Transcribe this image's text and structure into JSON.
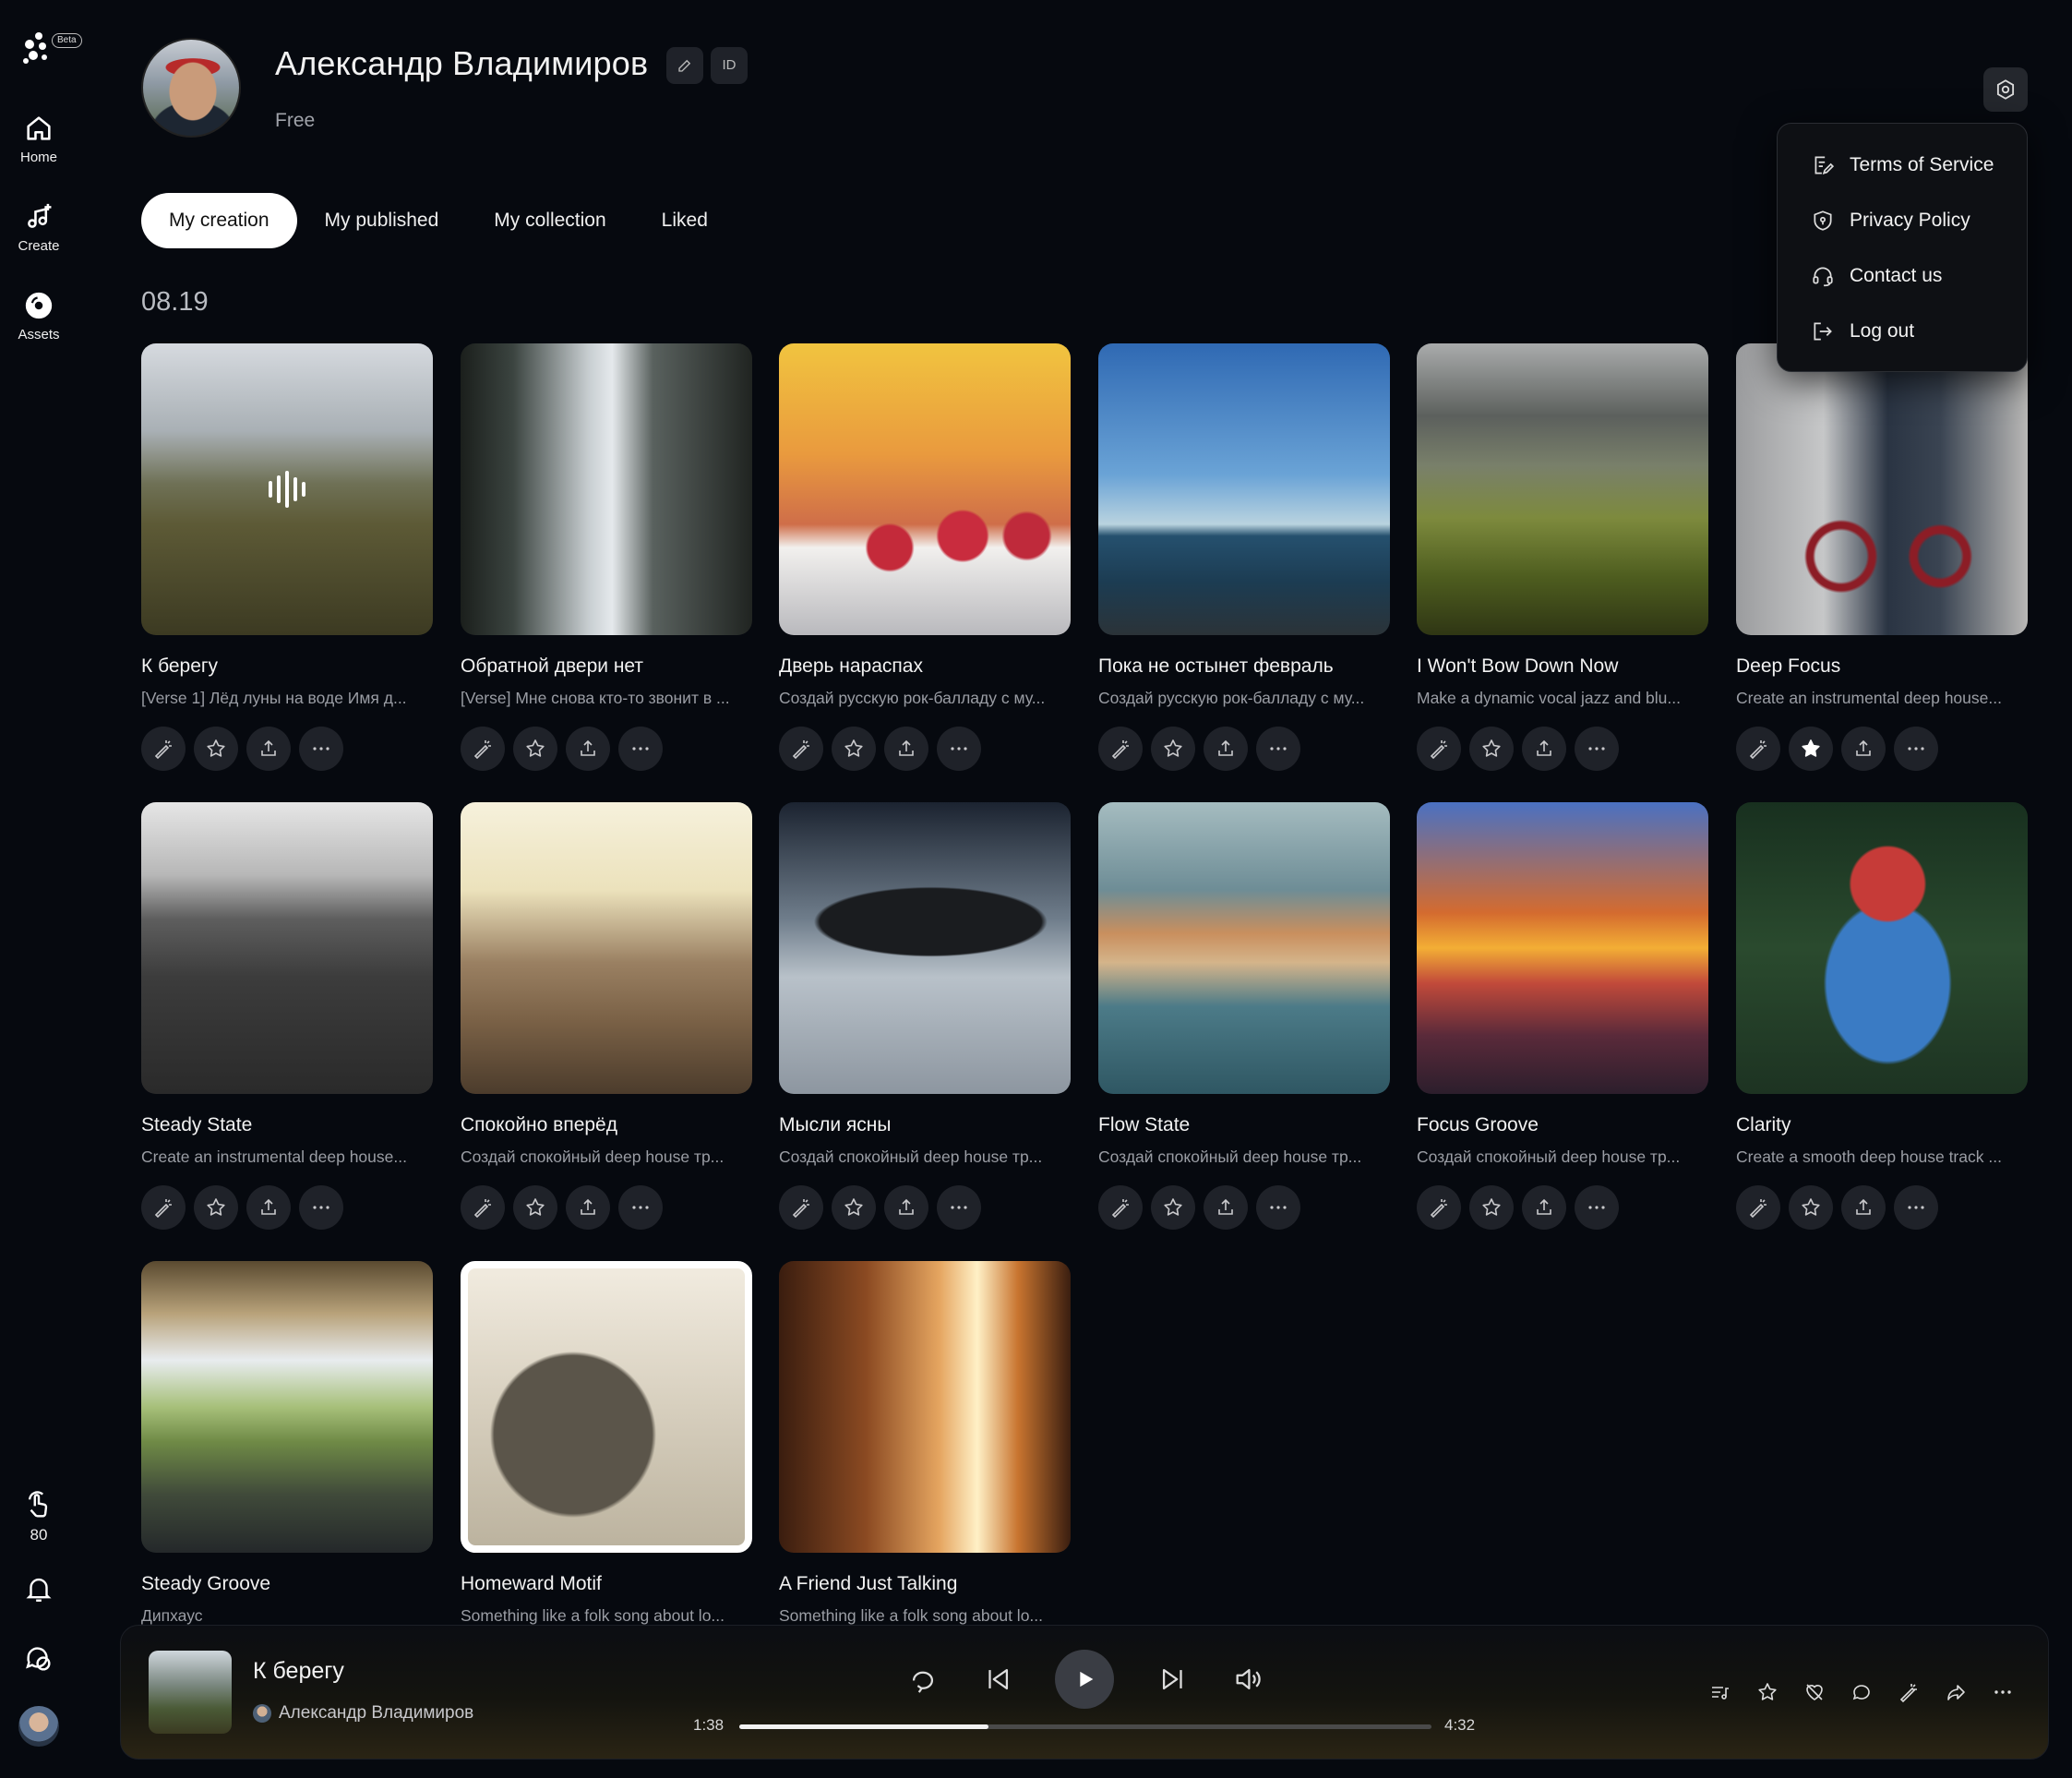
{
  "app": {
    "beta_label": "Beta"
  },
  "sidebar": {
    "items": [
      {
        "label": "Home",
        "icon": "home-icon"
      },
      {
        "label": "Create",
        "icon": "music-plus-icon"
      },
      {
        "label": "Assets",
        "icon": "disc-icon"
      }
    ],
    "credits": "80"
  },
  "profile": {
    "name": "Александр Владимиров",
    "plan": "Free",
    "id_label": "ID"
  },
  "tabs": [
    "My creation",
    "My published",
    "My collection",
    "Liked"
  ],
  "active_tab": "My creation",
  "date_group": "08.19",
  "menu": {
    "items": [
      {
        "label": "Terms of Service",
        "icon": "document-edit-icon"
      },
      {
        "label": "Privacy Policy",
        "icon": "shield-icon"
      },
      {
        "label": "Contact us",
        "icon": "headset-icon"
      },
      {
        "label": "Log out",
        "icon": "logout-icon"
      }
    ]
  },
  "cards": [
    {
      "title": "К берегу",
      "desc": "[Verse 1] Лёд луны на воде Имя д...",
      "starred": false,
      "playing": true
    },
    {
      "title": "Обратной двери нет",
      "desc": "[Verse] Мне снова кто-то звонит в ...",
      "starred": false
    },
    {
      "title": "Дверь нараспах",
      "desc": "Создай русскую рок-балладу с му...",
      "starred": false
    },
    {
      "title": "Пока не остынет февраль",
      "desc": "Создай русскую рок-балладу с му...",
      "starred": false
    },
    {
      "title": "I Won't Bow Down Now",
      "desc": "Make a dynamic vocal jazz and blu...",
      "starred": false
    },
    {
      "title": "Deep Focus",
      "desc": "Create an instrumental deep house...",
      "starred": true
    },
    {
      "title": "Steady State",
      "desc": "Create an instrumental deep house...",
      "starred": false
    },
    {
      "title": "Спокойно вперёд",
      "desc": "Создай спокойный deep house тр...",
      "starred": false
    },
    {
      "title": "Мысли ясны",
      "desc": "Создай спокойный deep house тр...",
      "starred": false
    },
    {
      "title": "Flow State",
      "desc": "Создай спокойный deep house тр...",
      "starred": false
    },
    {
      "title": "Focus Groove",
      "desc": "Создай спокойный deep house тр...",
      "starred": false
    },
    {
      "title": "Clarity",
      "desc": "Create a smooth deep house track ...",
      "starred": false
    },
    {
      "title": "Steady Groove",
      "desc": "Дипхаус",
      "starred": false
    },
    {
      "title": "Homeward Motif",
      "desc": "Something like a folk song about lo...",
      "starred": false
    },
    {
      "title": "A Friend Just Talking",
      "desc": "Something like a folk song about lo...",
      "starred": false
    }
  ],
  "player": {
    "title": "К берегу",
    "artist": "Александр Владимиров",
    "current_time": "1:38",
    "total_time": "4:32",
    "progress": 0.36
  }
}
